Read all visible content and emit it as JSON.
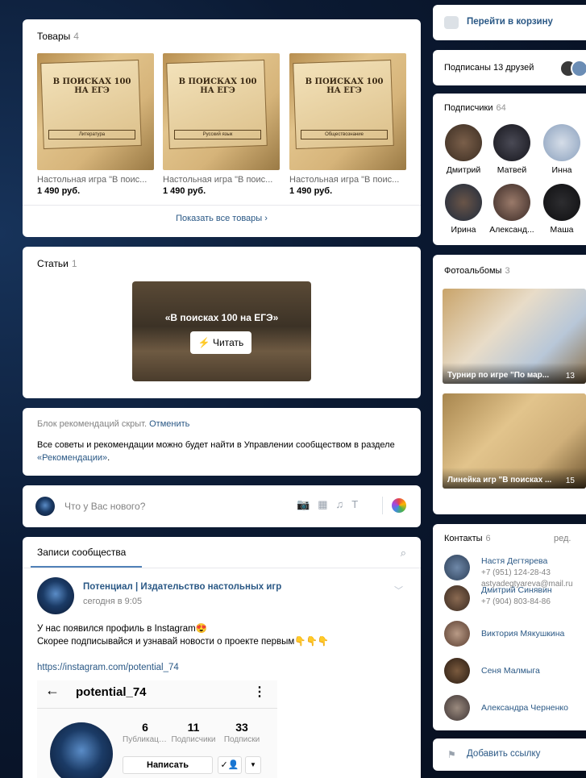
{
  "goods": {
    "title": "Товары",
    "count": "4",
    "items": [
      {
        "name": "Настольная игра \"В поис...",
        "price": "1 490 руб.",
        "cover_title": "В ПОИСКАХ 100 НА ЕГЭ",
        "cover_sub": "Литература"
      },
      {
        "name": "Настольная игра \"В поис...",
        "price": "1 490 руб.",
        "cover_title": "В ПОИСКАХ 100 НА ЕГЭ",
        "cover_sub": "Русский язык"
      },
      {
        "name": "Настольная игра \"В поис...",
        "price": "1 490 руб.",
        "cover_title": "В ПОИСКАХ 100 НА ЕГЭ",
        "cover_sub": "Обществознание"
      }
    ],
    "show_all": "Показать все товары ›"
  },
  "articles": {
    "title": "Статьи",
    "count": "1",
    "cover_title": "«В поисках 100 на ЕГЭ»",
    "read_label": "⚡ Читать"
  },
  "recs": {
    "hidden_text": "Блок рекомендаций скрыт.",
    "undo_label": "Отменить",
    "info_text": "Все советы и рекомендации можно будет найти в Управлении сообществом в разделе ",
    "info_link": "«Рекомендации»",
    "info_end": "."
  },
  "postbox": {
    "placeholder": "Что у Вас нового?",
    "icons": [
      "camera-icon",
      "video-icon",
      "music-icon",
      "text-icon",
      "color-icon"
    ]
  },
  "wall": {
    "tab_label": "Записи сообщества",
    "author": "Потенциал | Издательство настольных игр",
    "date": "сегодня в 9:05",
    "text_line1": "У нас появился профиль в Instagram😍",
    "text_line2": "Скорее подписывайся и узнавай новости о проекте первым👇👇👇",
    "url": "https://instagram.com/potential_74",
    "instagram": {
      "username": "potential_74",
      "stats": [
        {
          "n": "6",
          "label": "Публикации"
        },
        {
          "n": "11",
          "label": "Подписчики"
        },
        {
          "n": "33",
          "label": "Подписки"
        }
      ],
      "write_label": "Написать",
      "follow_icon": "✓👤",
      "more_icon": "▼"
    }
  },
  "cart": {
    "label": "Перейти в корзину"
  },
  "friends": {
    "label": "Подписаны 13 друзей"
  },
  "subscribers": {
    "title": "Подписчики",
    "count": "64",
    "people": [
      {
        "name": "Дмитрий"
      },
      {
        "name": "Матвей"
      },
      {
        "name": "Инна"
      },
      {
        "name": "Ирина"
      },
      {
        "name": "Александ..."
      },
      {
        "name": "Маша"
      }
    ]
  },
  "albums": {
    "title": "Фотоальбомы",
    "count": "3",
    "items": [
      {
        "title": "Турнир по игре \"По мар...",
        "count": "13"
      },
      {
        "title": "Линейка игр \"В поисках ...",
        "count": "15"
      }
    ]
  },
  "contacts": {
    "title": "Контакты",
    "count": "6",
    "edit_label": "ред.",
    "people": [
      {
        "name": "Настя Дегтярева",
        "phone": "+7 (951) 124-28-43",
        "email": "astyadegtyareva@mail.ru"
      },
      {
        "name": "Дмитрий Синявин",
        "phone": "+7 (904) 803-84-86",
        "email": ""
      },
      {
        "name": "Виктория Мякушкина",
        "phone": "",
        "email": ""
      },
      {
        "name": "Сеня Малмыга",
        "phone": "",
        "email": ""
      },
      {
        "name": "Александра Черненко",
        "phone": "",
        "email": ""
      }
    ]
  },
  "addlink": {
    "label": "Добавить ссылку"
  }
}
